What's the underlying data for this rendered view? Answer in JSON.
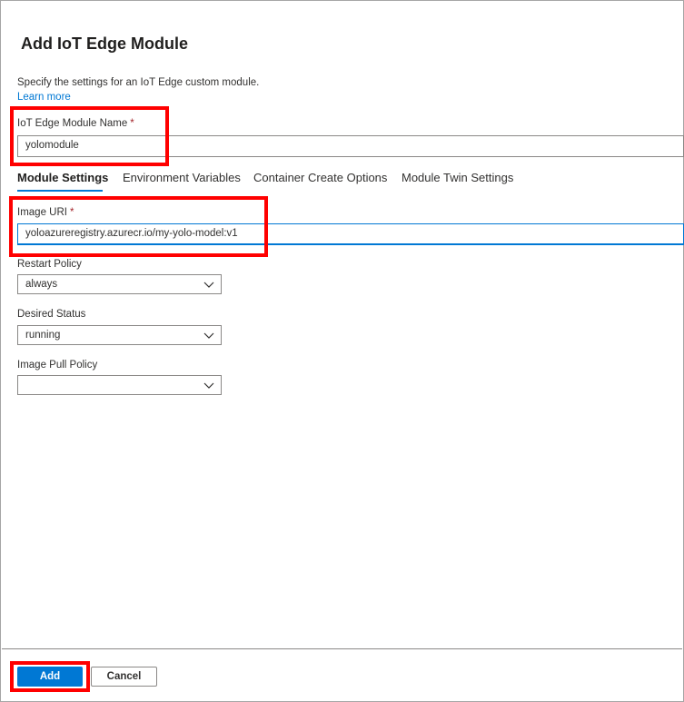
{
  "panel": {
    "title": "Add IoT Edge Module",
    "description": "Specify the settings for an IoT Edge custom module.",
    "learn_more": "Learn more"
  },
  "module_name": {
    "label": "IoT Edge Module Name",
    "required_mark": "*",
    "value": "yolomodule"
  },
  "tabs": [
    {
      "label": "Module Settings",
      "active": true
    },
    {
      "label": "Environment Variables",
      "active": false
    },
    {
      "label": "Container Create Options",
      "active": false
    },
    {
      "label": "Module Twin Settings",
      "active": false
    }
  ],
  "image_uri": {
    "label": "Image URI",
    "required_mark": "*",
    "value": "yoloazureregistry.azurecr.io/my-yolo-model:v1"
  },
  "restart_policy": {
    "label": "Restart Policy",
    "value": "always"
  },
  "desired_status": {
    "label": "Desired Status",
    "value": "running"
  },
  "image_pull_policy": {
    "label": "Image Pull Policy",
    "value": ""
  },
  "footer": {
    "add_label": "Add",
    "cancel_label": "Cancel"
  },
  "colors": {
    "accent": "#0078d4",
    "highlight": "#ff0000",
    "required": "#a4262c"
  }
}
